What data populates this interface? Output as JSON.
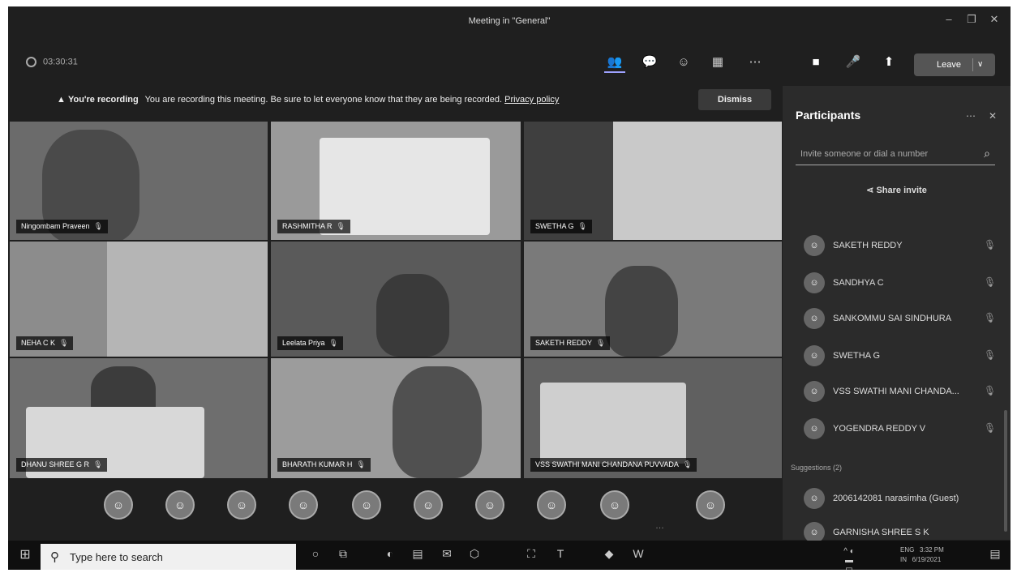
{
  "window": {
    "title": "Meeting in \"General\""
  },
  "meeting": {
    "timer": "03:30:31",
    "leave_label": "Leave"
  },
  "banner": {
    "bold": "You're recording",
    "text": "You are recording this meeting. Be sure to let everyone know that they are being recorded.",
    "link": "Privacy policy",
    "dismiss": "Dismiss"
  },
  "tiles": [
    {
      "name": "Ningombam Praveen"
    },
    {
      "name": "RASHMITHA R"
    },
    {
      "name": "SWETHA G"
    },
    {
      "name": "NEHA C K"
    },
    {
      "name": "Leelata Priya"
    },
    {
      "name": "SAKETH REDDY"
    },
    {
      "name": "DHANU SHREE G R"
    },
    {
      "name": "BHARATH KUMAR H"
    },
    {
      "name": "VSS SWATHI MANI CHANDANA PUVVADA"
    }
  ],
  "participants": {
    "title": "Participants",
    "search_placeholder": "Invite someone or dial a number",
    "share_invite": "Share invite",
    "list": [
      {
        "name": "SAKETH REDDY"
      },
      {
        "name": "SANDHYA C"
      },
      {
        "name": "SANKOMMU SAI SINDHURA"
      },
      {
        "name": "SWETHA G"
      },
      {
        "name": "VSS SWATHI MANI CHANDA..."
      },
      {
        "name": "YOGENDRA REDDY V"
      }
    ],
    "suggestions_label": "Suggestions (2)",
    "suggestions": [
      {
        "name": "2006142081 narasimha (Guest)"
      },
      {
        "name": "GARNISHA SHREE S K"
      }
    ]
  },
  "taskbar": {
    "search_placeholder": "Type here to search",
    "lang1": "ENG",
    "lang2": "IN",
    "time": "3:32 PM",
    "date": "6/19/2021"
  }
}
